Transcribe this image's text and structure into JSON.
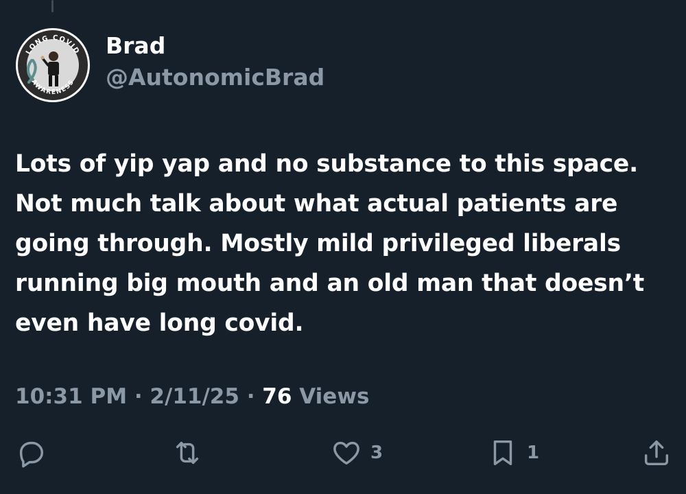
{
  "tweet": {
    "author": {
      "display_name": "Brad",
      "handle": "@AutonomicBrad",
      "avatar_badge_top": "LONG COVID",
      "avatar_badge_bottom": "AWARENESS"
    },
    "text": "Lots of yip yap and no substance to this space.\nNot much talk about what actual patients are\ngoing through. Mostly mild privileged liberals\nrunning big mouth and an old man that doesn’t\neven have long covid.",
    "time": "10:31 PM",
    "separator": " · ",
    "date": "2/11/25",
    "views_count": "76",
    "views_label": " Views",
    "actions": {
      "reply": {
        "icon": "reply-icon",
        "count": ""
      },
      "retweet": {
        "icon": "retweet-icon",
        "count": ""
      },
      "like": {
        "icon": "heart-icon",
        "count": "3"
      },
      "bookmark": {
        "icon": "bookmark-icon",
        "count": "1"
      },
      "share": {
        "icon": "share-icon",
        "count": ""
      }
    }
  },
  "colors": {
    "background": "#15202b",
    "primary_text": "#ffffff",
    "secondary_text": "#8b98a5",
    "awareness_ribbon": "#5b8f8f"
  }
}
